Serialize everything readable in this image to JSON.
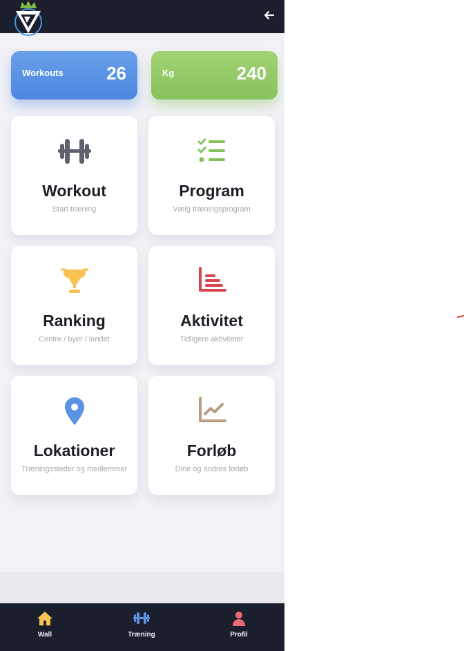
{
  "header": {
    "logo_icon": "crown-triangle-logo",
    "back_icon": "arrow-left-icon"
  },
  "stats": [
    {
      "label": "Workouts",
      "value": "26",
      "color": "#5a92e4"
    },
    {
      "label": "Kg",
      "value": "240",
      "color": "#94c966"
    }
  ],
  "tiles": [
    {
      "title": "Workout",
      "subtitle": "Start træning",
      "icon": "dumbbell-icon",
      "icon_color": "#5e626e"
    },
    {
      "title": "Program",
      "subtitle": "Vælg træningsprogram",
      "icon": "checklist-icon",
      "icon_color": "#86c25b"
    },
    {
      "title": "Ranking",
      "subtitle": "Centre / byer / landet",
      "icon": "trophy-icon",
      "icon_color": "#f6c252"
    },
    {
      "title": "Aktivitet",
      "subtitle": "Tidligere aktiviteter",
      "icon": "bar-list-icon",
      "icon_color": "#d9454f"
    },
    {
      "title": "Lokationer",
      "subtitle": "Træningssteder og medlemmer",
      "icon": "map-pin-icon",
      "icon_color": "#5a92e4"
    },
    {
      "title": "Forløb",
      "subtitle": "Dine og andres forløb",
      "icon": "line-chart-icon",
      "icon_color": "#b99b7f"
    }
  ],
  "bottom_nav": [
    {
      "label": "Wall",
      "icon": "home-icon",
      "icon_color": "#f6c252"
    },
    {
      "label": "Træning",
      "icon": "dumbbell-icon",
      "icon_color": "#5a92e4"
    },
    {
      "label": "Profil",
      "icon": "user-icon",
      "icon_color": "#e86a72"
    }
  ]
}
